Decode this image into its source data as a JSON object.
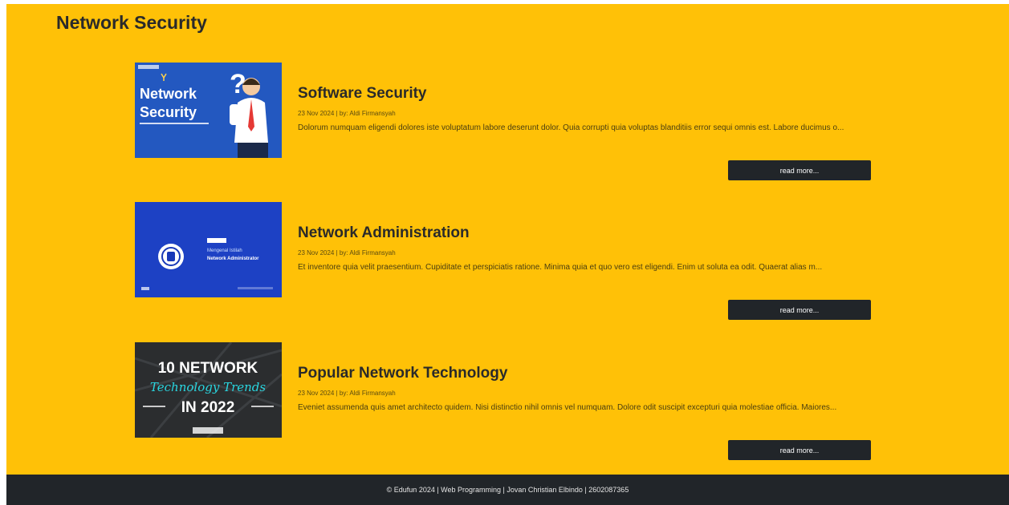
{
  "page": {
    "title": "Network Security"
  },
  "articles": [
    {
      "title": "Software Security",
      "meta": "23 Nov 2024 | by: Aldi Firmansyah",
      "excerpt": "Dolorum numquam eligendi dolores iste voluptatum labore deserunt dolor. Quia corrupti quia voluptas blanditiis error sequi omnis est. Labore ducimus o...",
      "read_more_label": "read more...",
      "image": {
        "line1": "Network",
        "line2": "Security"
      }
    },
    {
      "title": "Network Administration",
      "meta": "23 Nov 2024 | by: Aldi Firmansyah",
      "excerpt": "Et inventore quia velit praesentium. Cupiditate et perspiciatis ratione. Minima quia et quo vero est eligendi. Enim ut soluta ea odit. Quaerat alias m...",
      "read_more_label": "read more...",
      "image": {
        "line1": "Mengenal Istilah",
        "line2": "Network Administrator"
      }
    },
    {
      "title": "Popular Network Technology",
      "meta": "23 Nov 2024 | by: Aldi Firmansyah",
      "excerpt": "Eveniet assumenda quis amet architecto quidem. Nisi distinctio nihil omnis vel numquam. Dolore odit suscipit excepturi quia molestiae officia. Maiores...",
      "read_more_label": "read more...",
      "image": {
        "line1": "10 NETWORK",
        "line2": "Technology Trends",
        "line3": "IN 2022"
      }
    }
  ],
  "footer": {
    "text": "© Edufun 2024 | Web Programming | Jovan Christian Elbindo | 2602087365"
  },
  "colors": {
    "page_bg": "#ffc107",
    "dark": "#212529",
    "text": "#2a2a2a"
  }
}
